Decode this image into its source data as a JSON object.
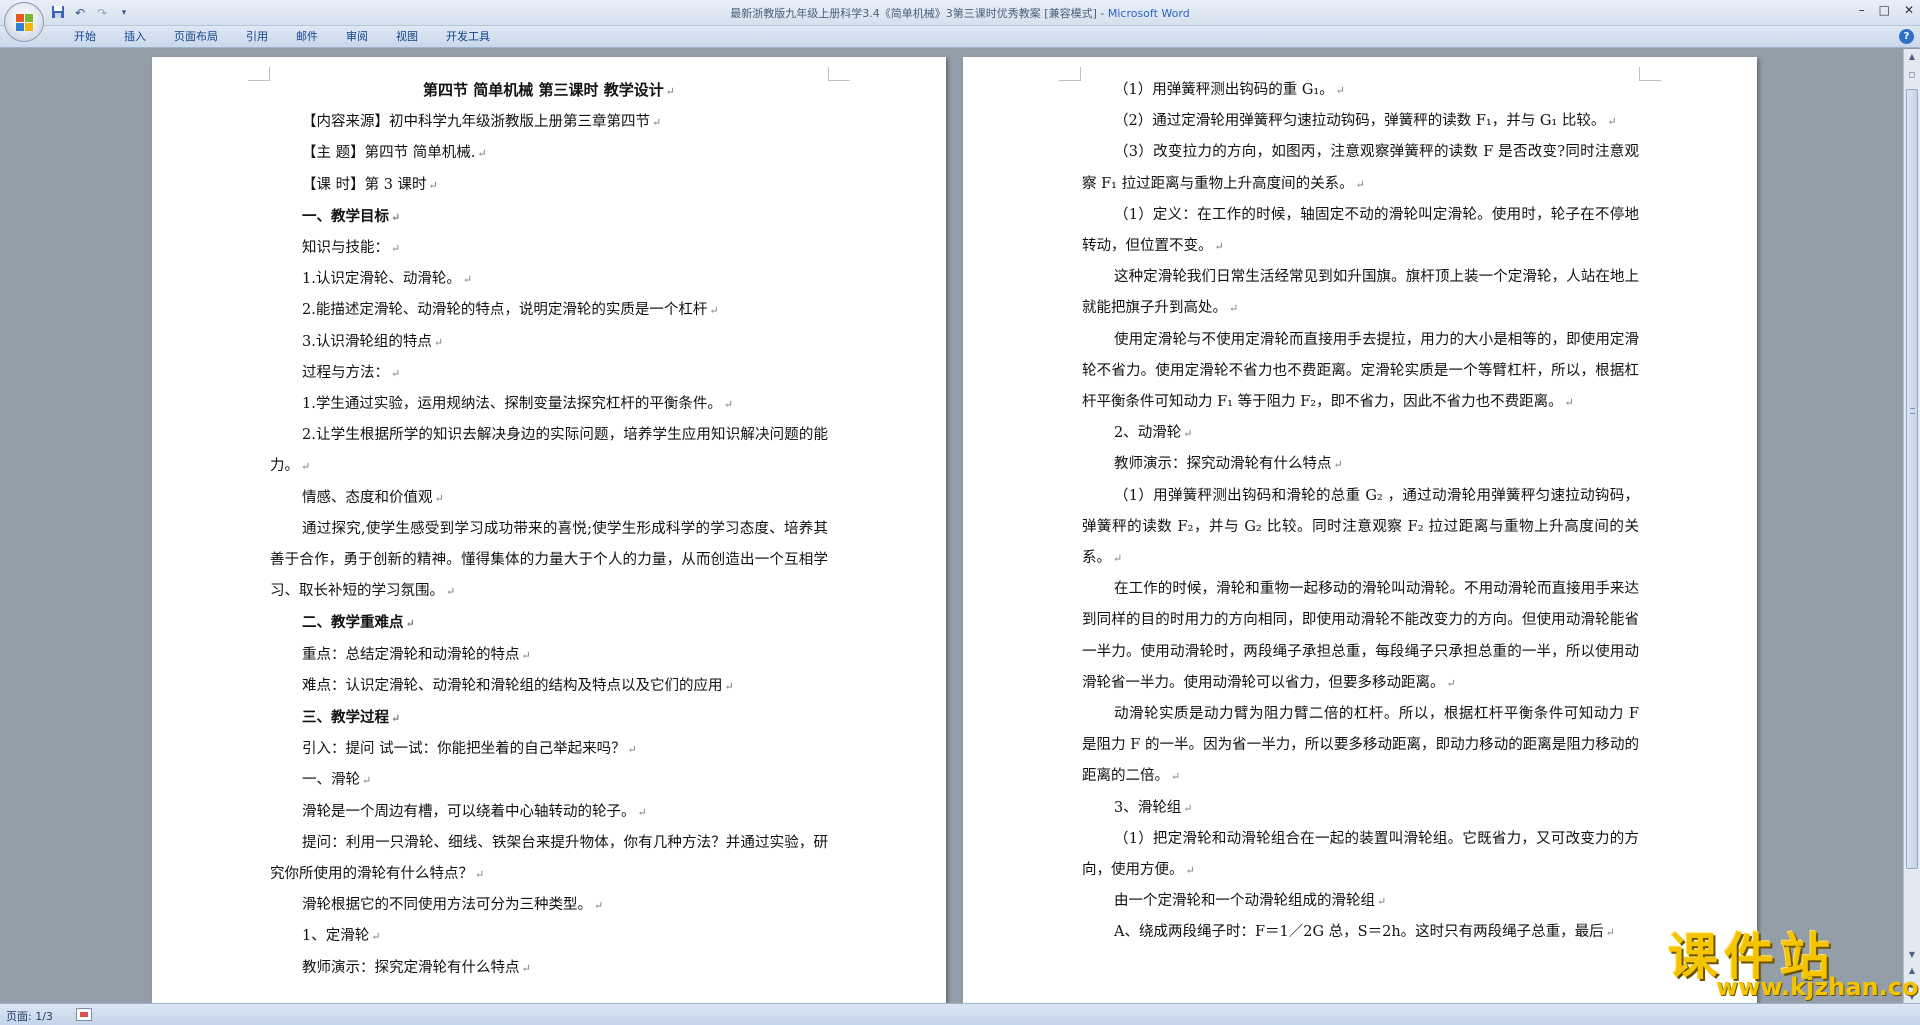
{
  "window": {
    "title": "最新浙教版九年级上册科学3.4《简单机械》3第三课时优秀教案 [兼容模式] - ",
    "app_name": "Microsoft Word",
    "controls": [
      "–",
      "□",
      "✕"
    ]
  },
  "quick_access": {
    "save_icon": "save-icon",
    "undo_icon": "undo-icon",
    "redo_icon": "redo-icon",
    "customize_icon": "customize-icon"
  },
  "ribbon": {
    "tabs": [
      "开始",
      "插入",
      "页面布局",
      "引用",
      "邮件",
      "审阅",
      "视图",
      "开发工具"
    ],
    "help": "?"
  },
  "left_page": {
    "title": "第四节  简单机械  第三课时  教学设计",
    "lines": [
      "【内容来源】初中科学九年级浙教版上册第三章第四节",
      "【主        题】第四节  简单机械.",
      "【课        时】第 3 课时",
      "一、教学目标",
      "知识与技能：",
      "1.认识定滑轮、动滑轮。",
      "2.能描述定滑轮、动滑轮的特点，说明定滑轮的实质是一个杠杆",
      "3.认识滑轮组的特点",
      "过程与方法：",
      "1.学生通过实验，运用规纳法、探制变量法探究杠杆的平衡条件。",
      "2.让学生根据所学的知识去解决身边的实际问题，培养学生应用知识解决问题的能力。",
      "情感、态度和价值观",
      "通过探究,使学生感受到学习成功带来的喜悦;使学生形成科学的学习态度、培养其善于合作，勇于创新的精神。懂得集体的力量大于个人的力量，从而创造出一个互相学习、取长补短的学习氛围。",
      "二、教学重难点",
      "重点：总结定滑轮和动滑轮的特点",
      "难点：认识定滑轮、动滑轮和滑轮组的结构及特点以及它们的应用",
      "三、教学过程",
      "引入：提问  试一试：你能把坐着的自己举起来吗？",
      "一、滑轮",
      "滑轮是一个周边有槽，可以绕着中心轴转动的轮子。",
      "提问：利用一只滑轮、细线、铁架台来提升物体，你有几种方法？并通过实验，研究你所使用的滑轮有什么特点？",
      "滑轮根据它的不同使用方法可分为三种类型。",
      "1、定滑轮",
      "教师演示：探究定滑轮有什么特点"
    ]
  },
  "right_page": {
    "lines": [
      "（1）用弹簧秤测出钩码的重 G₁。",
      "（2）通过定滑轮用弹簧秤匀速拉动钩码，弹簧秤的读数 F₁，并与 G₁ 比较。",
      "（3）改变拉力的方向，如图丙，注意观察弹簧秤的读数 F 是否改变?同时注意观察 F₁ 拉过距离与重物上升高度间的关系。",
      "（1）定义：在工作的时候，轴固定不动的滑轮叫定滑轮。使用时，轮子在不停地转动，但位置不变。",
      "这种定滑轮我们日常生活经常见到如升国旗。旗杆顶上装一个定滑轮，人站在地上就能把旗子升到高处。",
      "使用定滑轮与不使用定滑轮而直接用手去提拉，用力的大小是相等的，即使用定滑轮不省力。使用定滑轮不省力也不费距离。定滑轮实质是一个等臂杠杆，所以，根据杠杆平衡条件可知动力 F₁ 等于阻力 F₂，即不省力，因此不省力也不费距离。",
      "2、动滑轮",
      "教师演示：探究动滑轮有什么特点",
      "（1）用弹簧秤测出钩码和滑轮的总重 G₂ ，通过动滑轮用弹簧秤匀速拉动钩码，弹簧秤的读数 F₂，并与 G₂ 比较。同时注意观察 F₂ 拉过距离与重物上升高度间的关系。",
      "在工作的时候，滑轮和重物一起移动的滑轮叫动滑轮。不用动滑轮而直接用手来达到同样的目的时用力的方向相同，即使用动滑轮不能改变力的方向。但使用动滑轮能省一半力。使用动滑轮时，两段绳子承担总重，每段绳子只承担总重的一半，所以使用动滑轮省一半力。使用动滑轮可以省力，但要多移动距离。",
      "动滑轮实质是动力臂为阻力臂二倍的杠杆。所以，根据杠杆平衡条件可知动力 F 是阻力 F 的一半。因为省一半力，所以要多移动距离，即动力移动的距离是阻力移动的距离的二倍。",
      "3、滑轮组",
      "（1）把定滑轮和动滑轮组合在一起的装置叫滑轮组。它既省力，又可改变力的方向，使用方便。",
      "由一个定滑轮和一个动滑轮组成的滑轮组",
      "A、绕成两段绳子时：F＝1／2G 总，S＝2h。这时只有两段绳子总重，最后"
    ]
  },
  "statusbar": {
    "page": "页面: 1/3"
  },
  "watermark": {
    "text": "课件站",
    "url": "www.kjzhan.com"
  }
}
